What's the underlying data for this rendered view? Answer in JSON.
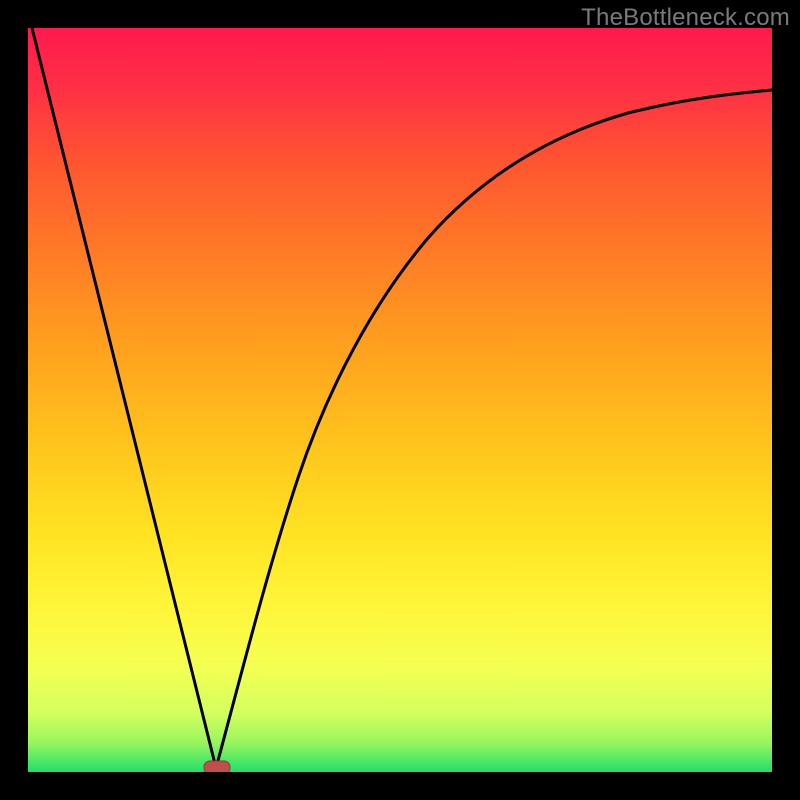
{
  "watermark": "TheBottleneck.com",
  "colors": {
    "black": "#000000",
    "watermark": "#7a7a7a",
    "stroke": "#000000",
    "marker_fill": "#c14d4d",
    "marker_stroke": "#8f3a3a"
  },
  "chart_data": {
    "type": "line",
    "title": "",
    "xlabel": "",
    "ylabel": "",
    "xlim": [
      0,
      100
    ],
    "ylim": [
      0,
      100
    ],
    "grid": false,
    "legend": false,
    "background": "gradient_red_to_green_vertical",
    "curve_segments": [
      {
        "name": "left-linear",
        "x": [
          0,
          25
        ],
        "y": [
          100,
          0
        ]
      },
      {
        "name": "right-sqrt-like",
        "x": [
          25,
          26,
          28,
          30,
          33,
          37,
          42,
          48,
          55,
          63,
          72,
          82,
          92,
          100
        ],
        "y": [
          0,
          11,
          22,
          30,
          38,
          46,
          54,
          61,
          68,
          74,
          80,
          84,
          87,
          89
        ]
      }
    ],
    "marker": {
      "x": 25,
      "y": 0,
      "shape": "rounded-rect"
    },
    "gradient_bands_approx": [
      {
        "y_pct": 0,
        "color": "#ff1a4d"
      },
      {
        "y_pct": 25,
        "color": "#ff6a29"
      },
      {
        "y_pct": 50,
        "color": "#ffbf1f"
      },
      {
        "y_pct": 75,
        "color": "#f6f02a"
      },
      {
        "y_pct": 92,
        "color": "#e6ff66"
      },
      {
        "y_pct": 100,
        "color": "#1fe06a"
      }
    ]
  }
}
